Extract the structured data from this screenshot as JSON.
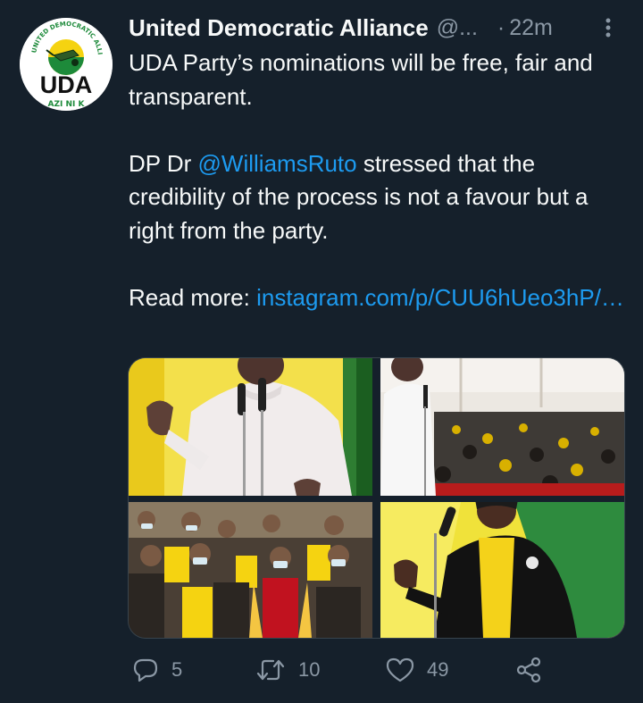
{
  "tweet": {
    "display_name": "United Democratic Alliance",
    "handle": "@...",
    "separator": "·",
    "time": "22m",
    "body": {
      "line1": "UDA Party’s nominations will be free, fair and transparent.",
      "line2_prefix": "DP Dr ",
      "line2_mention": "@WilliamsRuto",
      "line2_suffix": " stressed that the credibility of the process is not a favour but a right from the party.",
      "line3_prefix": "Read more: ",
      "line3_link": "instagram.com/p/CUU6hUeo3hP/…"
    },
    "avatar": {
      "arc_text": "UNITED DEMOCRATIC ALLIANCE",
      "logo_text": "UDA",
      "motto_text": "AZI NI K"
    },
    "media": [
      {
        "name": "speaker-at-podium-photo",
        "icon": "photo"
      },
      {
        "name": "speaker-and-audience-tent-photo",
        "icon": "photo"
      },
      {
        "name": "seated-audience-masks-photo",
        "icon": "photo"
      },
      {
        "name": "woman-speaker-photo",
        "icon": "photo"
      }
    ],
    "actions": {
      "reply_icon": "reply-icon",
      "reply_count": "5",
      "retweet_icon": "retweet-icon",
      "retweet_count": "10",
      "like_icon": "heart-icon",
      "like_count": "49",
      "share_icon": "share-icon"
    },
    "colors": {
      "background": "#15202b",
      "text": "#f7f9f9",
      "muted": "#8b98a5",
      "link": "#1d9bf0",
      "brand_yellow": "#f5d311",
      "brand_green": "#1d8a3a"
    }
  }
}
